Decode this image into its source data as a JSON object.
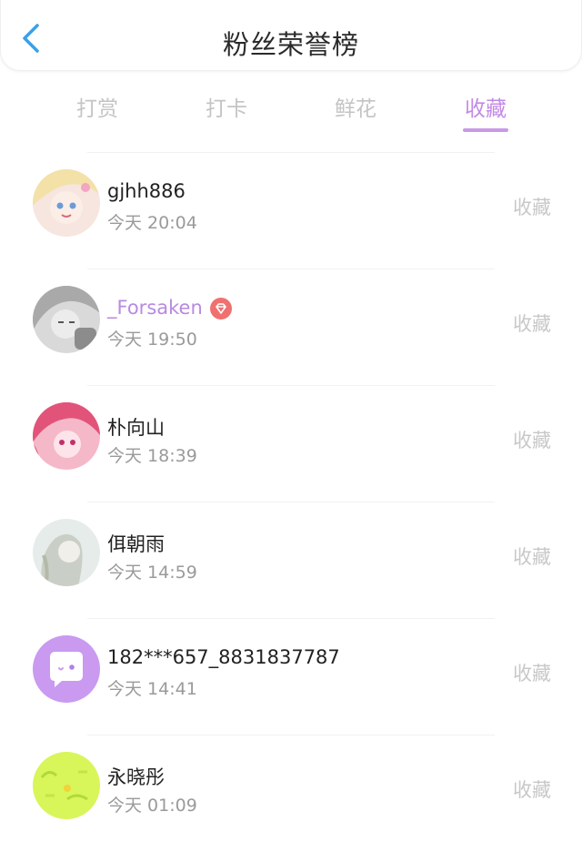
{
  "header": {
    "title": "粉丝荣誉榜"
  },
  "tabs": [
    {
      "label": "打赏"
    },
    {
      "label": "打卡"
    },
    {
      "label": "鲜花"
    },
    {
      "label": "收藏"
    }
  ],
  "active_tab": "收藏",
  "items": [
    {
      "name": "gjhh886",
      "time": "今天 20:04",
      "action": "收藏"
    },
    {
      "name": "_Forsaken",
      "time": "今天 19:50",
      "action": "收藏",
      "badge": "diamond-badge-icon"
    },
    {
      "name": "朴向山",
      "time": "今天 18:39",
      "action": "收藏"
    },
    {
      "name": "佴朝雨",
      "time": "今天 14:59",
      "action": "收藏"
    },
    {
      "name": "182***657_8831837787",
      "time": "今天 14:41",
      "action": "收藏"
    },
    {
      "name": "永晓彤",
      "time": "今天 01:09",
      "action": "收藏"
    }
  ],
  "colors": {
    "accent": "#c38ae6",
    "back": "#3aa0e8",
    "badge": "#f07070"
  }
}
